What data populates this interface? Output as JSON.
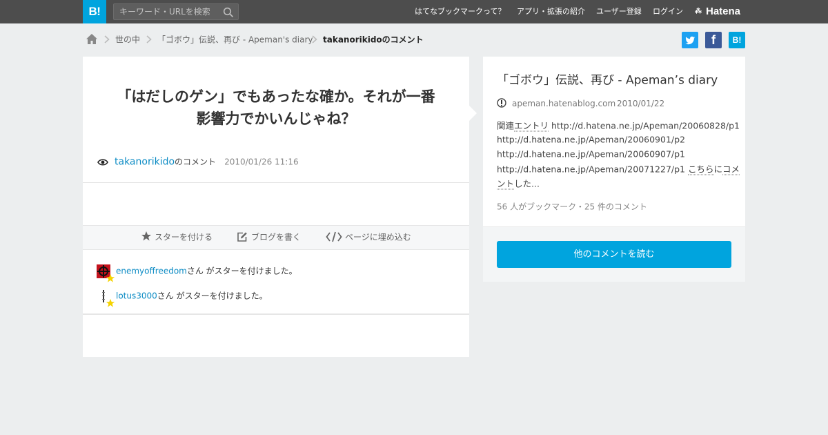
{
  "header": {
    "logo_text": "B!",
    "search_placeholder": "キーワード・URLを検索",
    "nav": [
      {
        "label": "はてなブックマークって？"
      },
      {
        "label": "アプリ・拡張の紹介"
      },
      {
        "label": "ユーザー登録"
      },
      {
        "label": "ログイン"
      }
    ],
    "brand": "Hatena",
    "brand_mark": "⁂",
    "background_color": "#4d4d4d",
    "accent_color": "#00a4de"
  },
  "breadcrumb": [
    {
      "label": "世の中"
    },
    {
      "label": "「ゴボウ」伝説、再び - Apeman's diary"
    },
    {
      "label": "takanorikidoのコメント"
    }
  ],
  "share": {
    "twitter_icon": "twitter-bird",
    "facebook_label": "f",
    "hatena_label": "B!"
  },
  "comment": {
    "text_line1": "「はだしのゲン」でもあったな確か。それが一番",
    "text_line2": "影響力でかいんじゃね？",
    "user": "takanorikido",
    "user_suffix": "のコメント",
    "date": "2010/01/26 11:16"
  },
  "actions": [
    {
      "label": "スターを付ける",
      "icon": "star"
    },
    {
      "label": "ブログを書く",
      "icon": "edit"
    },
    {
      "label": "ページに埋め込む",
      "icon": "code"
    }
  ],
  "stars": [
    {
      "user": "enemyoffreedom",
      "suffix": "さん がスターを付けました。"
    },
    {
      "user": "lotus3000",
      "suffix": "さん がスターを付けました。"
    }
  ],
  "entry": {
    "title": "「ゴボウ」伝説、再び - Apeman’s diary",
    "domain": "apeman.hatenablog.com",
    "date": "2010/01/22",
    "summary": {
      "line1_pre": "関連",
      "line1_u": "エントリ",
      "line1_post": " http://d.hatena.ne.jp/Apeman/20060828/p1",
      "line2": "http://d.hatena.ne.jp/Apeman/20060901/p2",
      "line3": "http://d.hatena.ne.jp/Apeman/20060907/p1",
      "line4_pre": "http://d.hatena.ne.jp/Apeman/20071227/p1 ",
      "line4_u1": "こちら",
      "line4_mid": "に",
      "line4_u2": "コメ",
      "line5_u": "ント",
      "line5_post": "した..."
    },
    "stats": "56 人がブックマーク・25 件のコメント",
    "read_button": "他のコメントを読む"
  }
}
